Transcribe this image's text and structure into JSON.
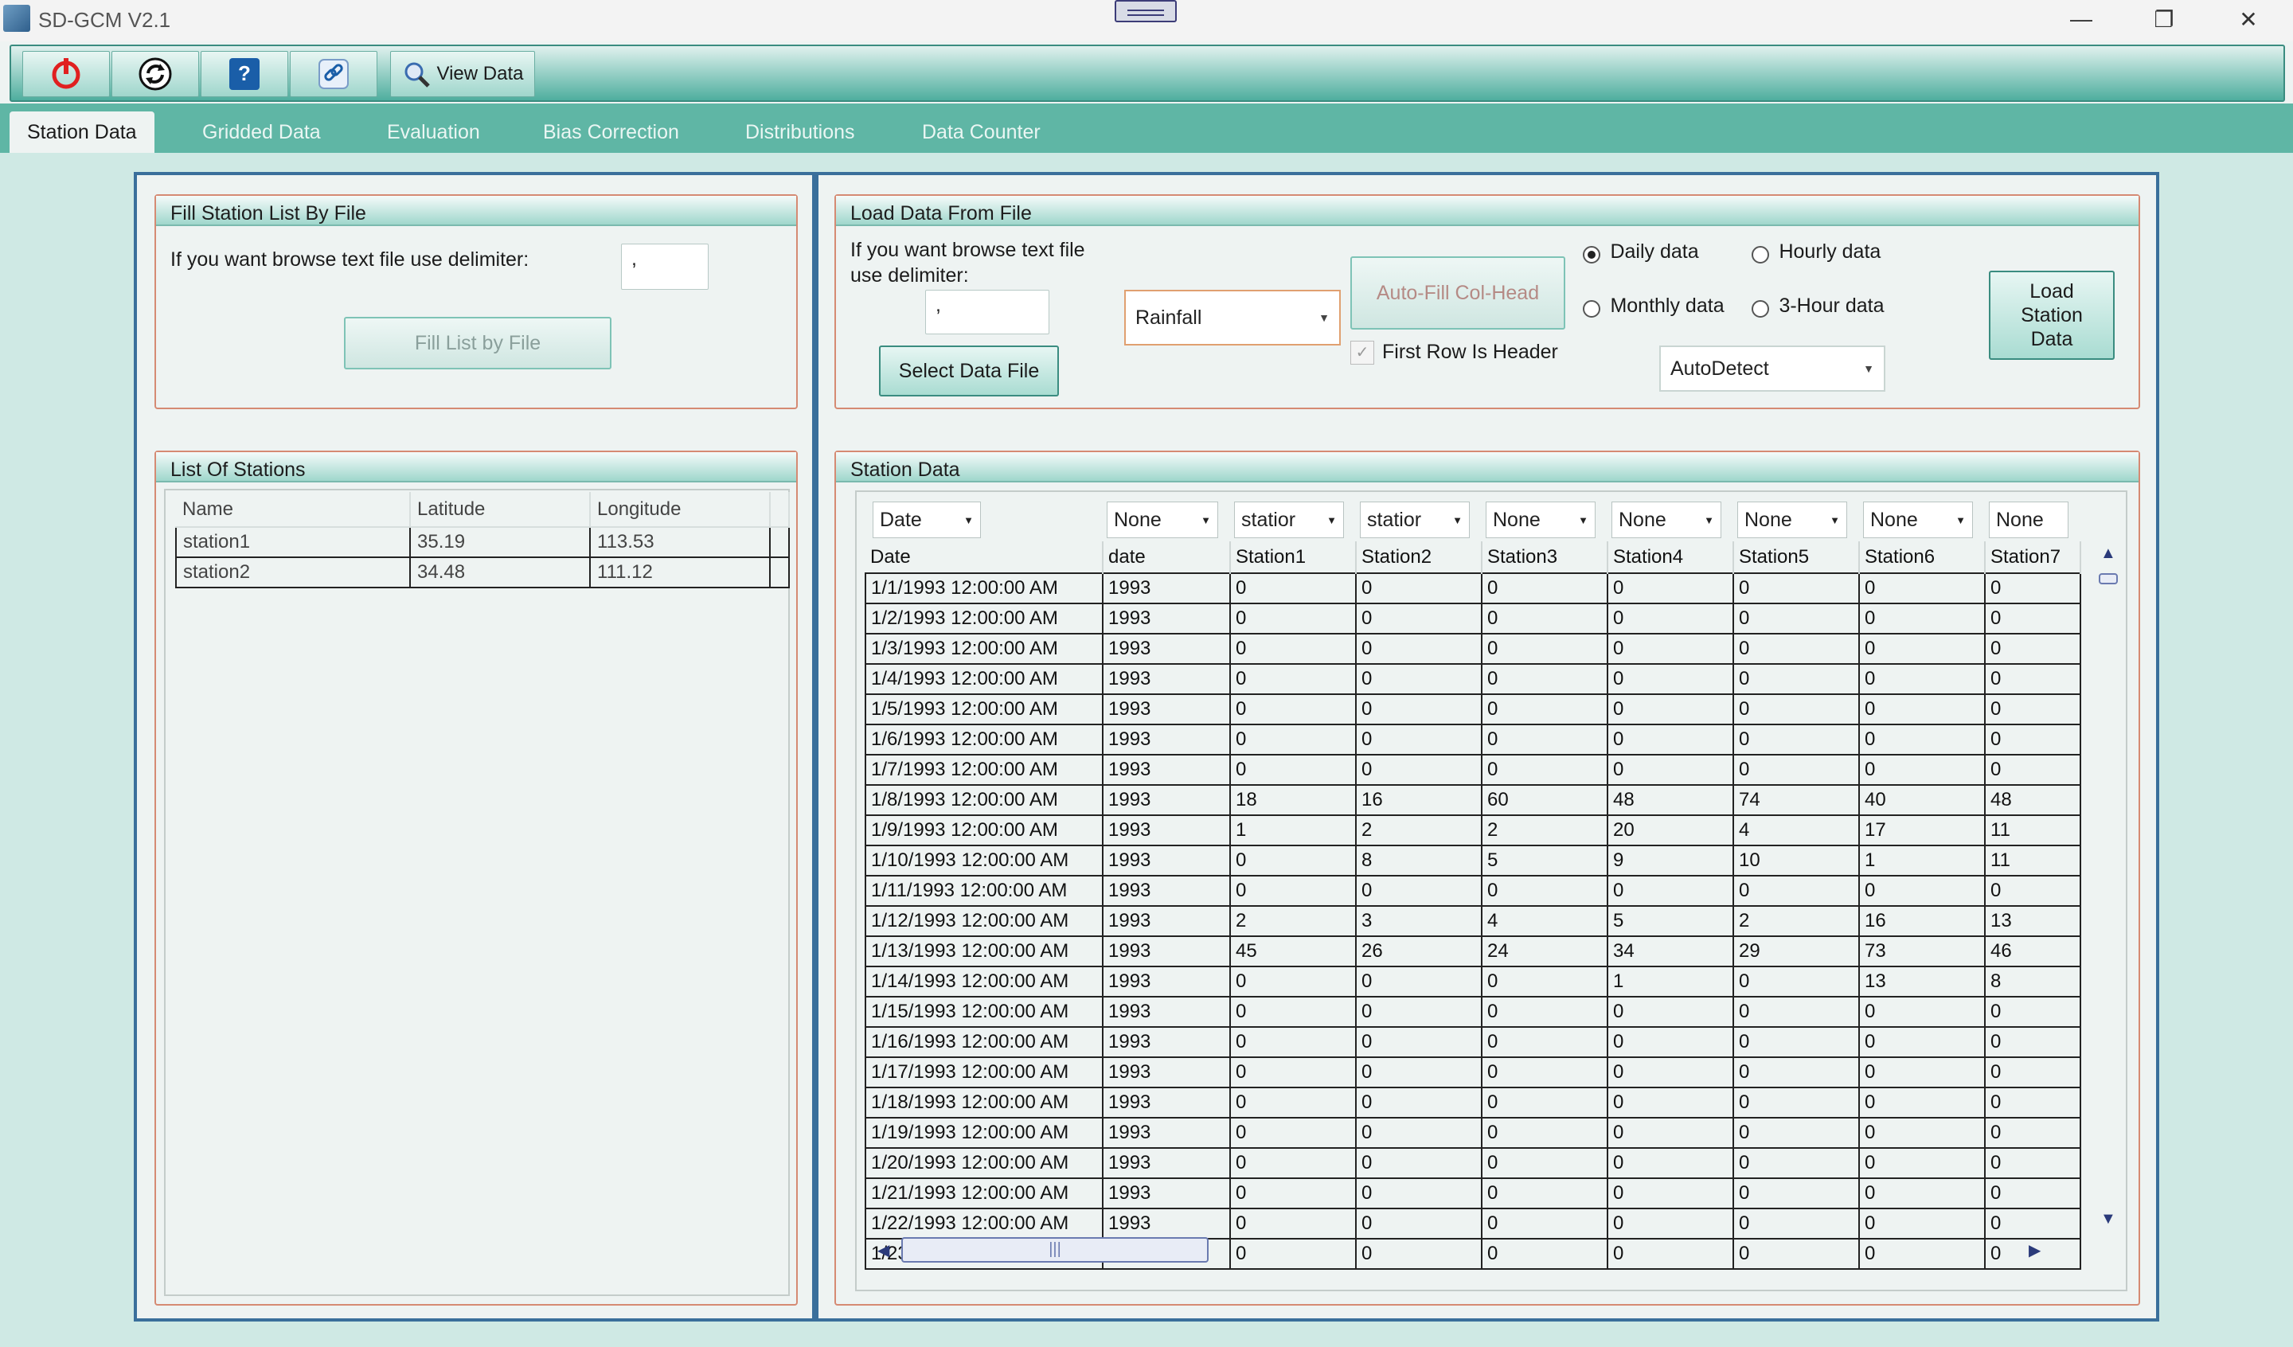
{
  "window": {
    "title": "SD-GCM V2.1",
    "controls": [
      "—",
      "❐",
      "✕"
    ]
  },
  "toolbar": {
    "view_data_label": "View Data"
  },
  "tabs": [
    "Station Data",
    "Gridded Data",
    "Evaluation",
    "Bias Correction",
    "Distributions",
    "Data Counter"
  ],
  "fill_station": {
    "header": "Fill Station List By File",
    "prompt": "If you want browse text file use delimiter:",
    "delimiter_value": ",",
    "button": "Fill List by File"
  },
  "load_data": {
    "header": "Load Data From File",
    "prompt_line1": "If you want browse text file",
    "prompt_line2": "use delimiter:",
    "delimiter_value": ",",
    "select_button": "Select Data File",
    "variable_selected": "Rainfall",
    "autofill_button": "Auto-Fill Col-Head",
    "first_row_header": "First Row Is Header",
    "radio_daily": "Daily data",
    "radio_hourly": "Hourly data",
    "radio_monthly": "Monthly data",
    "radio_3hour": "3-Hour data",
    "format_selected": "AutoDetect",
    "load_button_l1": "Load",
    "load_button_l2": "Station",
    "load_button_l3": "Data"
  },
  "stations": {
    "header": "List Of Stations",
    "columns": [
      "Name",
      "Latitude",
      "Longitude"
    ],
    "rows": [
      [
        "station1",
        "35.19",
        "113.53"
      ],
      [
        "station2",
        "34.48",
        "111.12"
      ]
    ]
  },
  "station_data": {
    "header": "Station Data",
    "col_combos": [
      "Date",
      "None",
      "statior",
      "statior",
      "None",
      "None",
      "None",
      "None",
      "None"
    ],
    "columns": [
      "Date",
      "date",
      "Station1",
      "Station2",
      "Station3",
      "Station4",
      "Station5",
      "Station6",
      "Station7"
    ],
    "rows": [
      [
        "1/1/1993 12:00:00 AM",
        "1993",
        "0",
        "0",
        "0",
        "0",
        "0",
        "0",
        "0"
      ],
      [
        "1/2/1993 12:00:00 AM",
        "1993",
        "0",
        "0",
        "0",
        "0",
        "0",
        "0",
        "0"
      ],
      [
        "1/3/1993 12:00:00 AM",
        "1993",
        "0",
        "0",
        "0",
        "0",
        "0",
        "0",
        "0"
      ],
      [
        "1/4/1993 12:00:00 AM",
        "1993",
        "0",
        "0",
        "0",
        "0",
        "0",
        "0",
        "0"
      ],
      [
        "1/5/1993 12:00:00 AM",
        "1993",
        "0",
        "0",
        "0",
        "0",
        "0",
        "0",
        "0"
      ],
      [
        "1/6/1993 12:00:00 AM",
        "1993",
        "0",
        "0",
        "0",
        "0",
        "0",
        "0",
        "0"
      ],
      [
        "1/7/1993 12:00:00 AM",
        "1993",
        "0",
        "0",
        "0",
        "0",
        "0",
        "0",
        "0"
      ],
      [
        "1/8/1993 12:00:00 AM",
        "1993",
        "18",
        "16",
        "60",
        "48",
        "74",
        "40",
        "48"
      ],
      [
        "1/9/1993 12:00:00 AM",
        "1993",
        "1",
        "2",
        "2",
        "20",
        "4",
        "17",
        "11"
      ],
      [
        "1/10/1993 12:00:00 AM",
        "1993",
        "0",
        "8",
        "5",
        "9",
        "10",
        "1",
        "11"
      ],
      [
        "1/11/1993 12:00:00 AM",
        "1993",
        "0",
        "0",
        "0",
        "0",
        "0",
        "0",
        "0"
      ],
      [
        "1/12/1993 12:00:00 AM",
        "1993",
        "2",
        "3",
        "4",
        "5",
        "2",
        "16",
        "13"
      ],
      [
        "1/13/1993 12:00:00 AM",
        "1993",
        "45",
        "26",
        "24",
        "34",
        "29",
        "73",
        "46"
      ],
      [
        "1/14/1993 12:00:00 AM",
        "1993",
        "0",
        "0",
        "0",
        "1",
        "0",
        "13",
        "8"
      ],
      [
        "1/15/1993 12:00:00 AM",
        "1993",
        "0",
        "0",
        "0",
        "0",
        "0",
        "0",
        "0"
      ],
      [
        "1/16/1993 12:00:00 AM",
        "1993",
        "0",
        "0",
        "0",
        "0",
        "0",
        "0",
        "0"
      ],
      [
        "1/17/1993 12:00:00 AM",
        "1993",
        "0",
        "0",
        "0",
        "0",
        "0",
        "0",
        "0"
      ],
      [
        "1/18/1993 12:00:00 AM",
        "1993",
        "0",
        "0",
        "0",
        "0",
        "0",
        "0",
        "0"
      ],
      [
        "1/19/1993 12:00:00 AM",
        "1993",
        "0",
        "0",
        "0",
        "0",
        "0",
        "0",
        "0"
      ],
      [
        "1/20/1993 12:00:00 AM",
        "1993",
        "0",
        "0",
        "0",
        "0",
        "0",
        "0",
        "0"
      ],
      [
        "1/21/1993 12:00:00 AM",
        "1993",
        "0",
        "0",
        "0",
        "0",
        "0",
        "0",
        "0"
      ],
      [
        "1/22/1993 12:00:00 AM",
        "1993",
        "0",
        "0",
        "0",
        "0",
        "0",
        "0",
        "0"
      ],
      [
        "1/23/1993 12:00:00 AM",
        "1993",
        "0",
        "0",
        "0",
        "0",
        "0",
        "0",
        "0"
      ]
    ]
  },
  "colors": {
    "accent": "#5fb6a5",
    "frame": "#3a6f9b",
    "group_border": "#d58a73"
  },
  "icons": [
    "power-icon",
    "refresh-icon",
    "help-icon",
    "link-icon",
    "magnifier-icon"
  ]
}
